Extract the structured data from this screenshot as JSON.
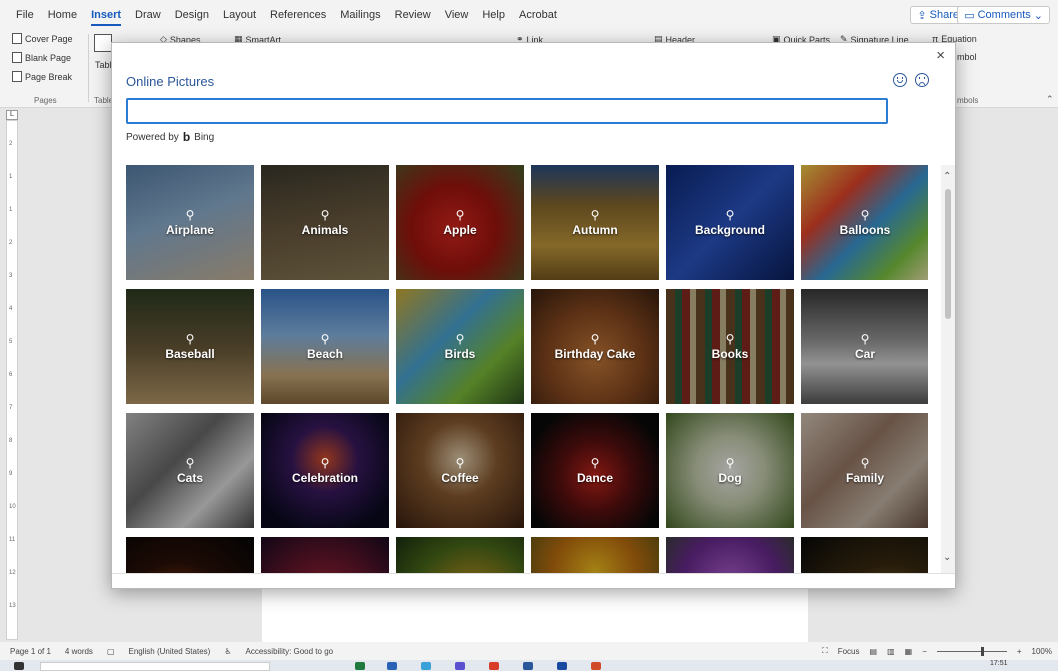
{
  "menubar": {
    "tabs": [
      "File",
      "Home",
      "Insert",
      "Draw",
      "Design",
      "Layout",
      "References",
      "Mailings",
      "Review",
      "View",
      "Help",
      "Acrobat"
    ],
    "active_tab": "Insert",
    "share_label": "Share",
    "comments_label": "Comments"
  },
  "ribbon": {
    "cover_page": "Cover Page",
    "blank_page": "Blank Page",
    "page_break": "Page Break",
    "pages_group": "Pages",
    "table_label": "Table",
    "tables_group": "Table",
    "shapes": "Shapes",
    "smartart": "SmartArt",
    "link": "Link",
    "header": "Header",
    "quick_parts": "Quick Parts",
    "signature_line": "Signature Line",
    "equation": "Equation",
    "symbol": "mbol",
    "symbols_group": "mbols"
  },
  "ruler_numbers": [
    "2",
    "1",
    "1",
    "2",
    "3",
    "4",
    "5",
    "6",
    "7",
    "8",
    "9",
    "10",
    "11",
    "12",
    "13"
  ],
  "dialog": {
    "title": "Online Pictures",
    "close_glyph": "×",
    "search_value": "",
    "powered_by": "Powered by",
    "bing": "Bing",
    "search_glyph": "⚲",
    "tiles": [
      {
        "label": "Airplane",
        "bg": "linear-gradient(160deg,#5a7fa8 0%,#8eb1d1 45%,#c9b59a 100%)"
      },
      {
        "label": "Animals",
        "bg": "linear-gradient(170deg,#3d3a2e 0%,#6b5a40 50%,#8a7a55 100%)"
      },
      {
        "label": "Apple",
        "bg": "radial-gradient(circle at 45% 55%,#d8271f 0%,#a3150f 45%,#4b5f2c 100%)"
      },
      {
        "label": "Autumn",
        "bg": "linear-gradient(180deg,#2d4f86 0%,#8a6a2c 35%,#c49a3c 70%,#7a5a20 100%)"
      },
      {
        "label": "Background",
        "bg": "linear-gradient(135deg,#0d2a7a 0%,#2b55c4 50%,#0a1e5c 100%)"
      },
      {
        "label": "Balloons",
        "bg": "linear-gradient(135deg,#f2d34a 0%,#e8452c 30%,#3a9ad8 55%,#7fc843 80%,#f0e8b0 100%)"
      },
      {
        "label": "Baseball",
        "bg": "linear-gradient(180deg,#2f3e24 0%,#6b5a3a 50%,#b89a6a 100%)"
      },
      {
        "label": "Beach",
        "bg": "linear-gradient(180deg,#3d7ac8 0%,#8ab8e6 40%,#c7a878 75%,#8a6a40 100%)"
      },
      {
        "label": "Birds",
        "bg": "linear-gradient(135deg,#d4b033 0%,#4aa7d8 40%,#7fbf3a 70%,#2d5020 100%)"
      },
      {
        "label": "Birthday Cake",
        "bg": "radial-gradient(circle at 50% 60%,#c47a3a 0%,#8a4a20 50%,#3a2010 100%)"
      },
      {
        "label": "Books",
        "bg": "repeating-linear-gradient(90deg,#6a4a2a 0 9px,#2a5a3a 9px 16px,#8a2a20 16px 24px,#c8b890 24px 30px)"
      },
      {
        "label": "Car",
        "bg": "linear-gradient(180deg,#3a3a3a 0%,#9a9a9a 45%,#d8d8d8 65%,#5a5a5a 100%)"
      },
      {
        "label": "Cats",
        "bg": "linear-gradient(135deg,#bfbfbf 0%,#6a6a6a 40%,#e0e0e0 70%,#4a4a4a 100%)"
      },
      {
        "label": "Celebration",
        "bg": "radial-gradient(circle at 50% 40%,#d8502a 0%,#3a1a60 35%,#0a0a20 80%)"
      },
      {
        "label": "Coffee",
        "bg": "radial-gradient(circle at 50% 40%,#e6d2b0 0%,#8a5a30 40%,#3a2010 100%)"
      },
      {
        "label": "Dance",
        "bg": "radial-gradient(circle at 50% 55%,#c2241c 0%,#5a1010 40%,#0a0a0a 80%)"
      },
      {
        "label": "Dog",
        "bg": "radial-gradient(circle at 50% 50%,#f4f4f0 0%,#c8d0b0 40%,#4a6a2a 100%)"
      },
      {
        "label": "Family",
        "bg": "linear-gradient(135deg,#d8c8b8 0%,#9a7a68 40%,#c8b8a8 70%,#6a5040 100%)"
      },
      {
        "label": "",
        "bg": "radial-gradient(circle at 40% 70%,#c8501a 0%,#2a1008 50%,#050505 100%)"
      },
      {
        "label": "",
        "bg": "radial-gradient(circle at 50% 60%,#e04a2a 0%,#7a1a30 40%,#1a0a20 100%)"
      },
      {
        "label": "",
        "bg": "radial-gradient(circle at 60% 60%,#e8a020 0%,#4a6a1a 60%,#1a3010 100%)"
      },
      {
        "label": "",
        "bg": "radial-gradient(circle at 50% 30%,#f2c020 0%,#c07010 40%,#2a4a18 100%)"
      },
      {
        "label": "",
        "bg": "radial-gradient(circle at 50% 40%,#b060d0 0%,#6a2a90 50%,#2a4a1a 100%)"
      },
      {
        "label": "",
        "bg": "radial-gradient(circle at 70% 80%,#c8a040 0%,#3a2a10 50%,#0a0a0a 100%)"
      }
    ]
  },
  "statusbar": {
    "page": "Page 1 of 1",
    "words": "4 words",
    "language": "English (United States)",
    "accessibility": "Accessibility: Good to go",
    "focus": "Focus",
    "zoom": "100%",
    "time": "17:51"
  }
}
